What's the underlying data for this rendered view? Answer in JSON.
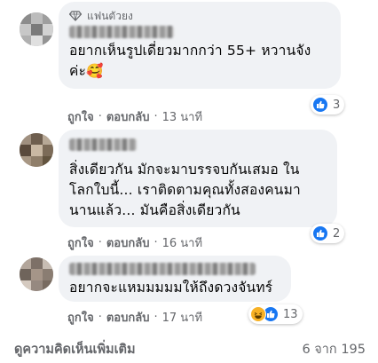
{
  "comments": [
    {
      "badge": "แฟนตัวยง",
      "text_lines": [
        "อยากเห็นรูปเดี่ยวมากกว่า 55+ หวานจัง",
        "ค่ะ🥰"
      ],
      "like": "ถูกใจ",
      "reply": "ตอบกลับ",
      "time": "13 นาที",
      "reaction_count": "3",
      "reactions": [
        "like-icon"
      ]
    },
    {
      "text_lines": [
        "สิ่งเดียวกัน มักจะมาบรรจบกันเสมอ ใน",
        "โลกใบนี้... เราติดตามคุณทั้งสองคนมา",
        "นานแล้ว... มันคือสิ่งเดียวกัน"
      ],
      "like": "ถูกใจ",
      "reply": "ตอบกลับ",
      "time": "16 นาที",
      "reaction_count": "2",
      "reactions": [
        "like-icon"
      ]
    },
    {
      "text_lines": [
        "อยากจะแหมมมมมให้ถึงดวงจันทร์"
      ],
      "like": "ถูกใจ",
      "reply": "ตอบกลับ",
      "time": "17 นาที",
      "reaction_count": "13",
      "reactions": [
        "haha-icon",
        "like-icon"
      ]
    }
  ],
  "footer": {
    "more_label": "ดูความคิดเห็นเพิ่มเติม",
    "pagination": "6 จาก 195"
  },
  "colors": {
    "bubble": "#f0f2f5",
    "secondary_text": "#65676b",
    "like_blue": "#1877f2",
    "haha_yellow": "#f7b125"
  }
}
